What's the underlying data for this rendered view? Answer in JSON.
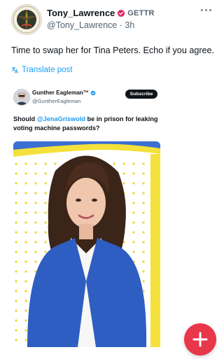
{
  "post": {
    "author": {
      "display_name": "Tony_Lawrence",
      "platform_badge": "GETTR",
      "handle": "@Tony_Lawrence",
      "separator": "·",
      "time": "3h"
    },
    "text": "Time to swap her for Tina Peters.  Echo if you agree.",
    "translate_label": "Translate post"
  },
  "quote": {
    "author": {
      "display_name": "Gunther Eagleman™",
      "handle": "@GuntherEagleman"
    },
    "subscribe_label": "Subscribe",
    "text_before": "Should ",
    "mention": "@JenaGriswold",
    "text_after": " be in prison for leaking voting machine passwords?"
  },
  "colors": {
    "accent_blue": "#1d9bf0",
    "verified_red": "#e0245e",
    "fab_red": "#e8374a",
    "photo_blue": "#3b6fd1",
    "photo_yellow": "#f4e13b"
  },
  "icons": {
    "more": "more-horizontal-icon",
    "translate": "translate-icon",
    "compose": "plus-icon"
  }
}
